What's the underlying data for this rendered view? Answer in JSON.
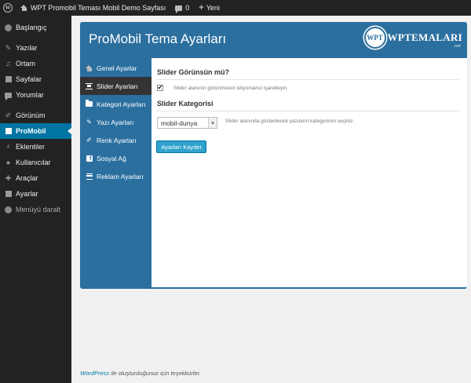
{
  "adminbar": {
    "site_title": "WPT Promobil Teması Mobil Demo Sayfası",
    "comments_count": "0",
    "new_label": "Yeni"
  },
  "sidebar": {
    "items": [
      {
        "label": "Başlangıç",
        "icon": "dashboard-icon"
      },
      {
        "label": "Yazılar",
        "icon": "pin-icon"
      },
      {
        "label": "Ortam",
        "icon": "media-icon"
      },
      {
        "label": "Sayfalar",
        "icon": "pages-icon"
      },
      {
        "label": "Yorumlar",
        "icon": "comments-icon"
      },
      {
        "label": "Görünüm",
        "icon": "appearance-icon"
      },
      {
        "label": "ProMobil",
        "icon": "mobile-icon"
      },
      {
        "label": "Eklentiler",
        "icon": "plugins-icon"
      },
      {
        "label": "Kullanıcılar",
        "icon": "users-icon"
      },
      {
        "label": "Araçlar",
        "icon": "tools-icon"
      },
      {
        "label": "Ayarlar",
        "icon": "settings-icon"
      },
      {
        "label": "Menüyü daralt",
        "icon": "collapse-icon"
      }
    ],
    "active": "ProMobil"
  },
  "panel": {
    "title": "ProMobil Tema Ayarları",
    "brand_badge": "WPT",
    "brand_text": "WPTEMALARI",
    "brand_suffix": ".net"
  },
  "tabs": [
    {
      "label": "Genel Ayarlar",
      "icon": "home-icon"
    },
    {
      "label": "Slider Ayarları",
      "icon": "slider-icon"
    },
    {
      "label": "Kategori Ayarları",
      "icon": "folder-icon"
    },
    {
      "label": "Yazı Ayarları",
      "icon": "pin-icon"
    },
    {
      "label": "Renk Ayarları",
      "icon": "brush-icon"
    },
    {
      "label": "Sosyal Ağ",
      "icon": "facebook-icon"
    },
    {
      "label": "Reklam Ayarları",
      "icon": "list-icon"
    }
  ],
  "active_tab": "Slider Ayarları",
  "form": {
    "slider_visible_title": "Slider Görünsün mü?",
    "slider_visible_hint": "Slider alanının görünmesini istiyorsanız işaretleyin.",
    "slider_visible_checked": true,
    "slider_category_title": "Slider Kategorisi",
    "slider_category_value": "mobil-dunya",
    "slider_category_hint": "Slider alanında gösterilecek yazıların kategorisini seçiniz.",
    "save_label": "Ayarları Kaydet"
  },
  "footer": {
    "link": "WordPress",
    "text": " ile oluşturduğunuz için teşekkürler."
  },
  "colors": {
    "panel_blue": "#2b6f9f",
    "admin_dark": "#222222",
    "active_menu": "#0074a2",
    "button": "#2ea2cc"
  }
}
